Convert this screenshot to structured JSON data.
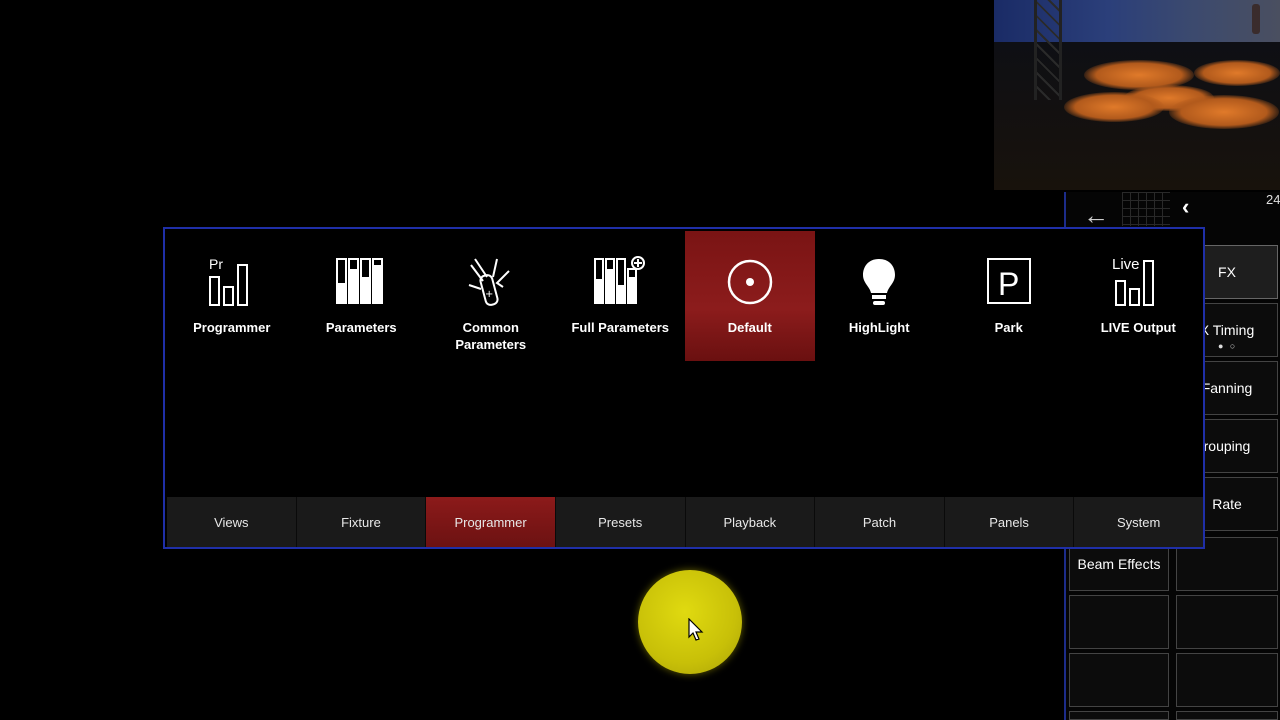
{
  "tiles": [
    {
      "label": "Programmer",
      "icon": "programmer-icon",
      "active": false
    },
    {
      "label": "Parameters",
      "icon": "parameters-icon",
      "active": false
    },
    {
      "label": "Common\nParameters",
      "icon": "swiss-knife-icon",
      "active": false
    },
    {
      "label": "Full Parameters",
      "icon": "full-parameters-icon",
      "active": false
    },
    {
      "label": "Default",
      "icon": "default-target-icon",
      "active": true
    },
    {
      "label": "HighLight",
      "icon": "lightbulb-icon",
      "active": false
    },
    {
      "label": "Park",
      "icon": "park-icon",
      "active": false
    },
    {
      "label": "LIVE Output",
      "icon": "live-output-icon",
      "active": false
    }
  ],
  "icon_text": {
    "programmer": "Pr",
    "park": "P",
    "live": "Live"
  },
  "tabs": [
    "Views",
    "Fixture",
    "Programmer",
    "Presets",
    "Playback",
    "Patch",
    "Panels",
    "System"
  ],
  "active_tab": "Programmer",
  "side": {
    "back_glyph": "←",
    "chevron_glyph": "‹",
    "number": "24",
    "buttons": [
      "FX",
      "X Timing",
      "Fanning",
      "rouping",
      "Rate",
      "Beam Effects"
    ],
    "timing_dots": "● ○"
  },
  "colors": {
    "accent_red": "#8c1c1c",
    "border_blue": "#1f2fa8",
    "cursor_yellow": "#d6d00c"
  }
}
